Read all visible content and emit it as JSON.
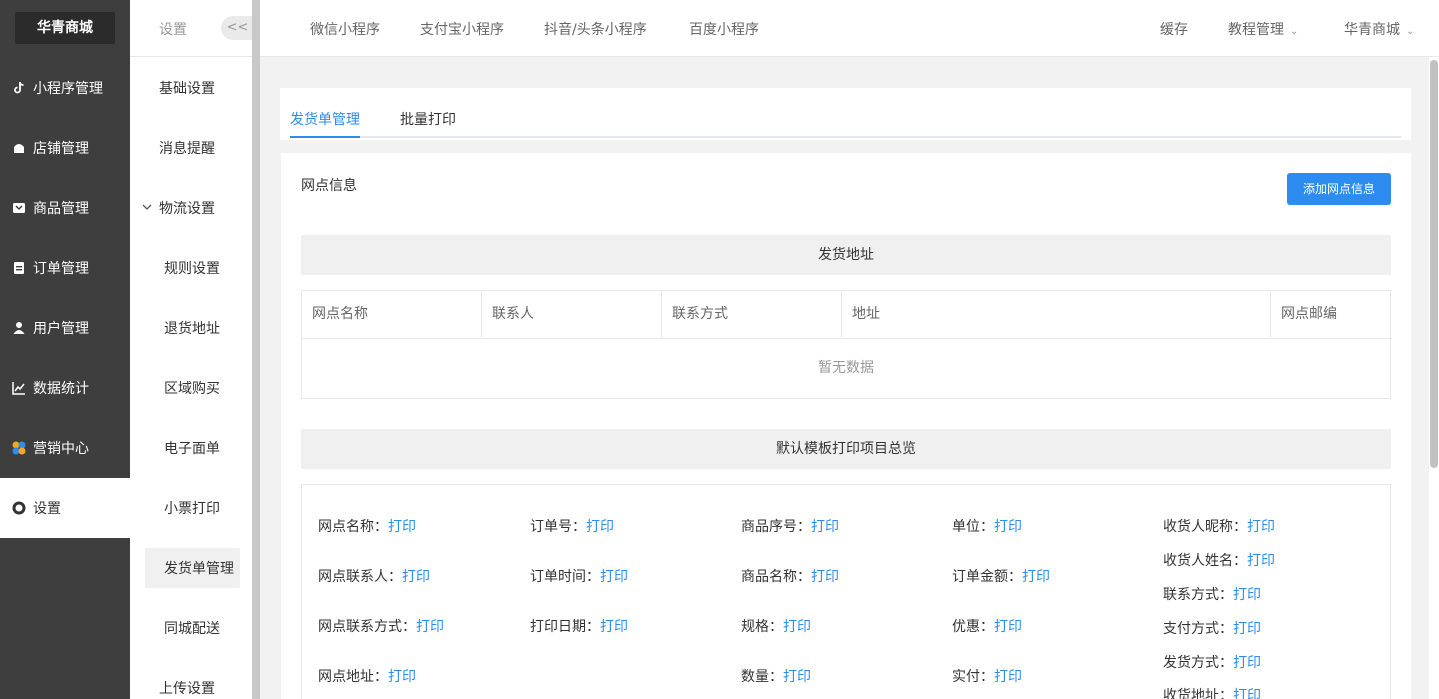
{
  "sidebar": {
    "brand": "华青商城",
    "items": [
      {
        "label": "小程序管理",
        "icon": "tiktok-icon"
      },
      {
        "label": "店铺管理",
        "icon": "store-icon"
      },
      {
        "label": "商品管理",
        "icon": "goods-icon"
      },
      {
        "label": "订单管理",
        "icon": "clipboard-icon"
      },
      {
        "label": "用户管理",
        "icon": "user-icon"
      },
      {
        "label": "数据统计",
        "icon": "chart-icon"
      },
      {
        "label": "营销中心",
        "icon": "marketing-icon"
      },
      {
        "label": "设置",
        "icon": "settings-icon"
      }
    ]
  },
  "subnav": {
    "title": "设置",
    "collapse": "<<",
    "items": [
      "基础设置",
      "消息提醒",
      "物流设置",
      "规则设置",
      "退货地址",
      "区域购买",
      "电子面单",
      "小票打印",
      "发货单管理",
      "同城配送",
      "上传设置"
    ]
  },
  "topbar": {
    "links": [
      "微信小程序",
      "支付宝小程序",
      "抖音/头条小程序",
      "百度小程序"
    ],
    "cache": "缓存",
    "tutorial": "教程管理",
    "shop": "华青商城"
  },
  "tabs": [
    "发货单管理",
    "批量打印"
  ],
  "section": {
    "title": "网点信息",
    "add_button": "添加网点信息",
    "band1": "发货地址",
    "band2": "默认模板打印项目总览",
    "empty": "暂无数据"
  },
  "table": {
    "headers": [
      "网点名称",
      "联系人",
      "联系方式",
      "地址",
      "网点邮编"
    ]
  },
  "overview": {
    "print": "打印",
    "labels": [
      "网点名称：",
      "网点联系人：",
      "网点联系方式：",
      "网点地址：",
      "订单号：",
      "订单时间：",
      "打印日期：",
      "商品序号：",
      "商品名称：",
      "规格：",
      "数量：",
      "单位：",
      "订单金额：",
      "优惠：",
      "实付：",
      "收货人昵称：",
      "收货人姓名：",
      "联系方式：",
      "支付方式：",
      "发货方式：",
      "收货地址："
    ]
  },
  "colors": {
    "accent": "#2d8cf0",
    "sidebar": "#3e3e3e"
  }
}
